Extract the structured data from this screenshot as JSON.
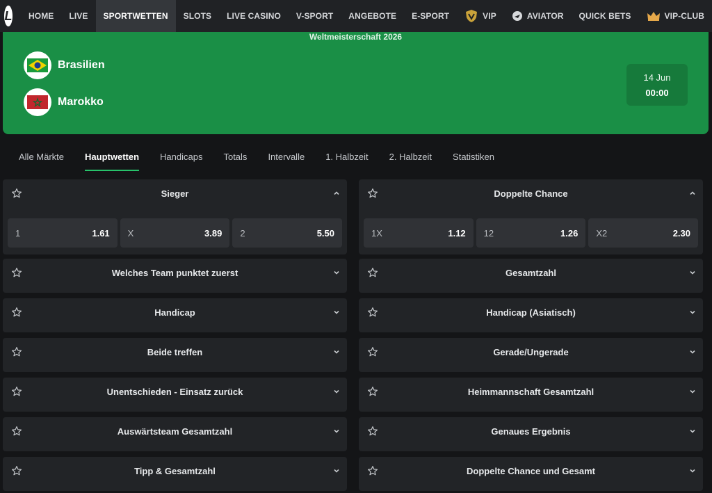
{
  "nav": {
    "logo": "L",
    "items": [
      {
        "label": "HOME"
      },
      {
        "label": "LIVE"
      },
      {
        "label": "SPORTWETTEN",
        "active": true
      },
      {
        "label": "SLOTS"
      },
      {
        "label": "LIVE CASINO"
      },
      {
        "label": "V-SPORT"
      },
      {
        "label": "ANGEBOTE"
      },
      {
        "label": "E-SPORT"
      },
      {
        "label": "VIP",
        "icon": "vip-shield-icon"
      },
      {
        "label": "AVIATOR",
        "icon": "aviator-icon"
      },
      {
        "label": "QUICK BETS"
      },
      {
        "label": "VIP-CLUB",
        "icon": "crown-icon"
      }
    ]
  },
  "match": {
    "competition": "Weltmeisterschaft 2026",
    "home": {
      "name": "Brasilien",
      "flag": "brazil-flag-icon"
    },
    "away": {
      "name": "Marokko",
      "flag": "morocco-flag-icon"
    },
    "date": "14 Jun",
    "time": "00:00"
  },
  "tabs": [
    {
      "label": "Alle Märkte"
    },
    {
      "label": "Hauptwetten",
      "active": true
    },
    {
      "label": "Handicaps"
    },
    {
      "label": "Totals"
    },
    {
      "label": "Intervalle"
    },
    {
      "label": "1. Halbzeit"
    },
    {
      "label": "2. Halbzeit"
    },
    {
      "label": "Statistiken"
    }
  ],
  "markets": {
    "left": [
      {
        "title": "Sieger",
        "expanded": true,
        "odds": [
          {
            "label": "1",
            "value": "1.61"
          },
          {
            "label": "X",
            "value": "3.89"
          },
          {
            "label": "2",
            "value": "5.50"
          }
        ]
      },
      {
        "title": "Welches Team punktet zuerst"
      },
      {
        "title": "Handicap"
      },
      {
        "title": "Beide treffen"
      },
      {
        "title": "Unentschieden - Einsatz zurück"
      },
      {
        "title": "Auswärtsteam Gesamtzahl"
      },
      {
        "title": "Tipp & Gesamtzahl"
      }
    ],
    "right": [
      {
        "title": "Doppelte Chance",
        "expanded": true,
        "odds": [
          {
            "label": "1X",
            "value": "1.12"
          },
          {
            "label": "12",
            "value": "1.26"
          },
          {
            "label": "X2",
            "value": "2.30"
          }
        ]
      },
      {
        "title": "Gesamtzahl"
      },
      {
        "title": "Handicap (Asiatisch)"
      },
      {
        "title": "Gerade/Ungerade"
      },
      {
        "title": "Heimmannschaft Gesamtzahl"
      },
      {
        "title": "Genaues Ergebnis"
      },
      {
        "title": "Doppelte Chance und Gesamt"
      }
    ]
  },
  "colors": {
    "accent": "#27c26a",
    "hero": "#1a8f46",
    "card": "#222427"
  }
}
